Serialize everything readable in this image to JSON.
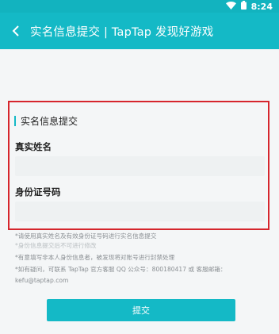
{
  "status_bar": {
    "time": "8:24",
    "icons": [
      "wifi-icon",
      "battery-icon"
    ]
  },
  "app_bar": {
    "back_icon": "chevron-left-icon",
    "title": "实名信息提交 | TapTap 发现好游戏"
  },
  "form": {
    "section_title": "实名信息提交",
    "name_label": "真实姓名",
    "name_value": "",
    "id_label": "身份证号码",
    "id_value": ""
  },
  "notes": {
    "note1": "*请使用真实姓名及有效身份证号码进行实名信息提交",
    "note2": "*身份信息提交后不可进行修改",
    "note3": "*有意填写非本人身份信息者，被发现将对账号进行封禁处理",
    "note4": "*如有疑问，可联系 TapTap 官方客服 QQ 公众号：800180417 或 客服邮箱：",
    "note5": "kefu@taptap.com"
  },
  "submit_label": "提交",
  "colors": {
    "accent": "#14b9c6",
    "highlight": "#d6262d"
  }
}
